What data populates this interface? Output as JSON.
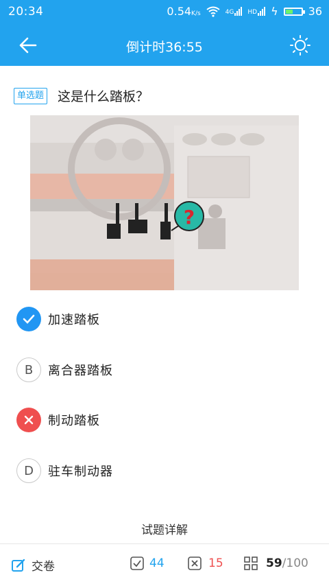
{
  "status_bar": {
    "time": "20:34",
    "speed": "0.54",
    "speed_unit": "K/s",
    "signal_label_1": "4G",
    "signal_label_2": "HD",
    "battery": "36"
  },
  "header": {
    "title": "倒计时36:55"
  },
  "question": {
    "type_badge": "单选题",
    "text": "这是什么踏板？"
  },
  "options": [
    {
      "marker": "",
      "state": "correct",
      "label": "加速踏板"
    },
    {
      "marker": "B",
      "state": "normal",
      "label": "离合器踏板"
    },
    {
      "marker": "",
      "state": "wrong",
      "label": "制动踏板"
    },
    {
      "marker": "D",
      "state": "normal",
      "label": "驻车制动器"
    }
  ],
  "explain_link": "试题详解",
  "bottom_bar": {
    "submit_label": "交卷",
    "correct_count": "44",
    "wrong_count": "15",
    "progress_current": "59",
    "progress_separator": "/",
    "progress_total": "100"
  },
  "colors": {
    "accent": "#22a3ee",
    "correct": "#2196f3",
    "wrong": "#ef4f4f"
  }
}
